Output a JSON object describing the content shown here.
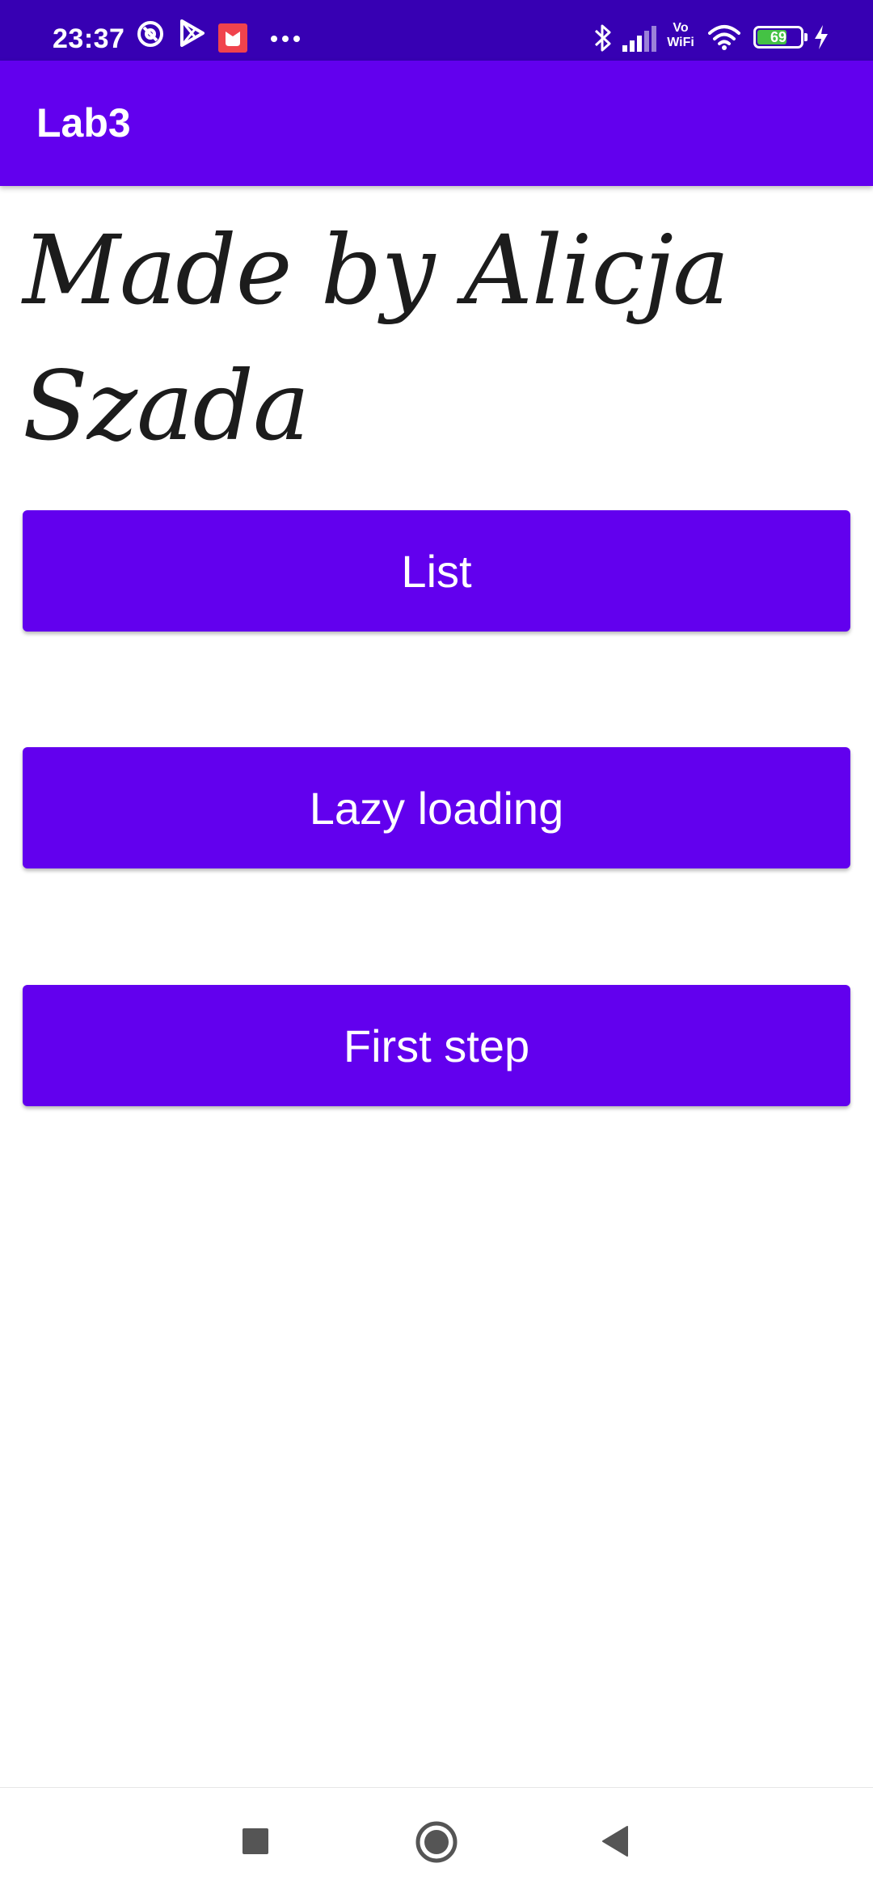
{
  "status_bar": {
    "time": "23:37",
    "battery_level": "69",
    "network_label_top": "Vo",
    "network_label_bottom": "WiFi",
    "icons": [
      "at-sign-icon",
      "play-store-icon",
      "app-notification-icon",
      "more-notifications-icon",
      "bluetooth-icon",
      "signal-icon",
      "wifi-icon",
      "battery-icon",
      "charging-icon"
    ]
  },
  "app_bar": {
    "title": "Lab3"
  },
  "main": {
    "credit_line1": "Made by Alicja",
    "credit_line2": "Szada",
    "buttons": [
      {
        "label": "List"
      },
      {
        "label": "Lazy loading"
      },
      {
        "label": "First step"
      }
    ]
  },
  "nav_bar": {
    "icons": [
      "recents-icon",
      "home-icon",
      "back-icon"
    ]
  },
  "colors": {
    "primary": "#6200ee",
    "primary_dark": "#3700b3",
    "on_primary": "#ffffff",
    "background": "#ffffff",
    "text": "#1c1c1c"
  }
}
